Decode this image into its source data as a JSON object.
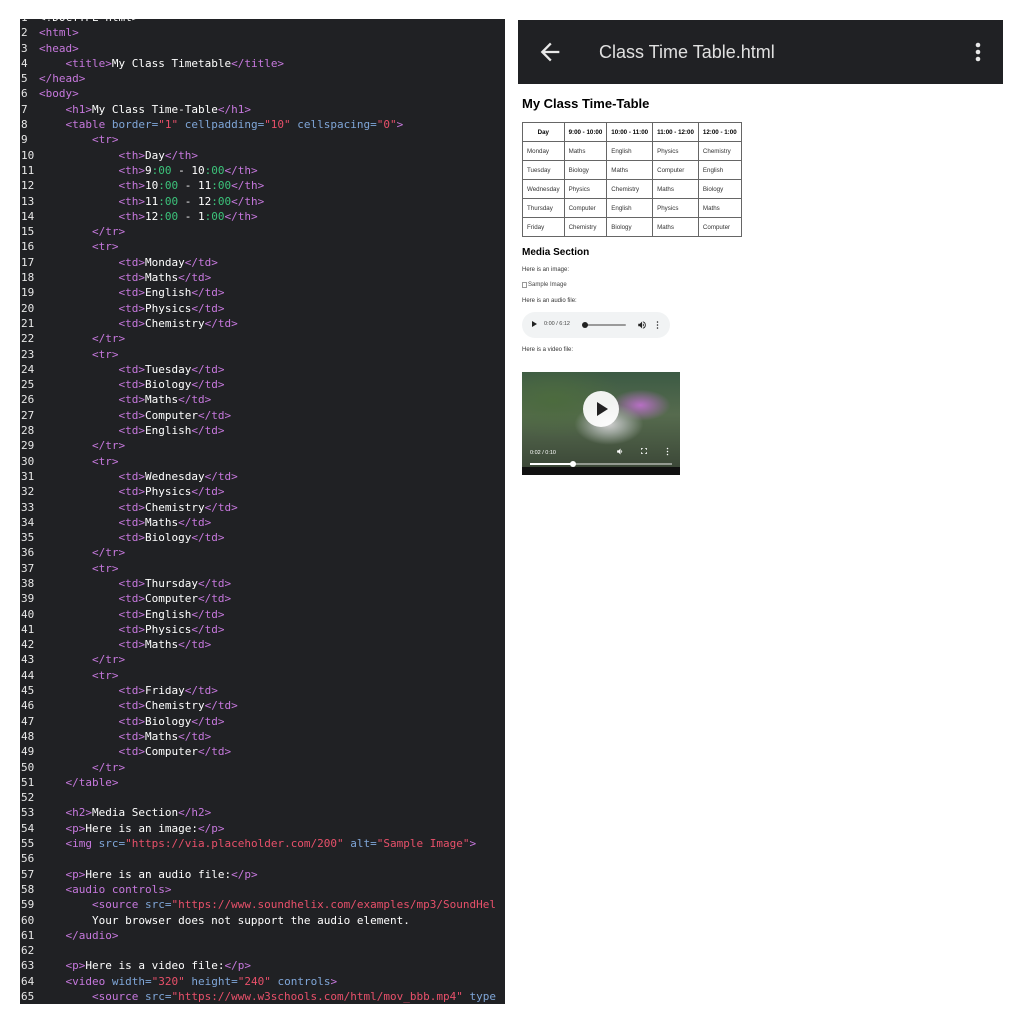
{
  "editor": {
    "lines": [
      [
        [
          "txt",
          "<!DOCTYPE html>"
        ]
      ],
      [
        [
          "tag",
          "<html>"
        ]
      ],
      [
        [
          "tag",
          "<head>"
        ]
      ],
      [
        [
          "txt",
          "    "
        ],
        [
          "tag",
          "<title>"
        ],
        [
          "txt",
          "My Class Timetable"
        ],
        [
          "tag",
          "</title>"
        ]
      ],
      [
        [
          "tag",
          "</head>"
        ]
      ],
      [
        [
          "tag",
          "<body>"
        ]
      ],
      [
        [
          "txt",
          "    "
        ],
        [
          "tag",
          "<h1>"
        ],
        [
          "txt",
          "My Class Time-Table"
        ],
        [
          "tag",
          "</h1>"
        ]
      ],
      [
        [
          "txt",
          "    "
        ],
        [
          "tag",
          "<table "
        ],
        [
          "attr",
          "border="
        ],
        [
          "str",
          "\"1\""
        ],
        [
          "attr",
          " cellpadding="
        ],
        [
          "str",
          "\"10\""
        ],
        [
          "attr",
          " cellspacing="
        ],
        [
          "str",
          "\"0\""
        ],
        [
          "tag",
          ">"
        ]
      ],
      [
        [
          "txt",
          "        "
        ],
        [
          "tag",
          "<tr>"
        ]
      ],
      [
        [
          "txt",
          "            "
        ],
        [
          "tag",
          "<th>"
        ],
        [
          "txt",
          "Day"
        ],
        [
          "tag",
          "</th>"
        ]
      ],
      [
        [
          "txt",
          "            "
        ],
        [
          "tag",
          "<th>"
        ],
        [
          "txt",
          "9"
        ],
        [
          "num",
          ":00"
        ],
        [
          "txt",
          " - 10"
        ],
        [
          "num",
          ":00"
        ],
        [
          "tag",
          "</th>"
        ]
      ],
      [
        [
          "txt",
          "            "
        ],
        [
          "tag",
          "<th>"
        ],
        [
          "txt",
          "10"
        ],
        [
          "num",
          ":00"
        ],
        [
          "txt",
          " - 11"
        ],
        [
          "num",
          ":00"
        ],
        [
          "tag",
          "</th>"
        ]
      ],
      [
        [
          "txt",
          "            "
        ],
        [
          "tag",
          "<th>"
        ],
        [
          "txt",
          "11"
        ],
        [
          "num",
          ":00"
        ],
        [
          "txt",
          " - 12"
        ],
        [
          "num",
          ":00"
        ],
        [
          "tag",
          "</th>"
        ]
      ],
      [
        [
          "txt",
          "            "
        ],
        [
          "tag",
          "<th>"
        ],
        [
          "txt",
          "12"
        ],
        [
          "num",
          ":00"
        ],
        [
          "txt",
          " - 1"
        ],
        [
          "num",
          ":00"
        ],
        [
          "tag",
          "</th>"
        ]
      ],
      [
        [
          "txt",
          "        "
        ],
        [
          "tag",
          "</tr>"
        ]
      ],
      [
        [
          "txt",
          "        "
        ],
        [
          "tag",
          "<tr>"
        ]
      ],
      [
        [
          "txt",
          "            "
        ],
        [
          "tag",
          "<td>"
        ],
        [
          "txt",
          "Monday"
        ],
        [
          "tag",
          "</td>"
        ]
      ],
      [
        [
          "txt",
          "            "
        ],
        [
          "tag",
          "<td>"
        ],
        [
          "txt",
          "Maths"
        ],
        [
          "tag",
          "</td>"
        ]
      ],
      [
        [
          "txt",
          "            "
        ],
        [
          "tag",
          "<td>"
        ],
        [
          "txt",
          "English"
        ],
        [
          "tag",
          "</td>"
        ]
      ],
      [
        [
          "txt",
          "            "
        ],
        [
          "tag",
          "<td>"
        ],
        [
          "txt",
          "Physics"
        ],
        [
          "tag",
          "</td>"
        ]
      ],
      [
        [
          "txt",
          "            "
        ],
        [
          "tag",
          "<td>"
        ],
        [
          "txt",
          "Chemistry"
        ],
        [
          "tag",
          "</td>"
        ]
      ],
      [
        [
          "txt",
          "        "
        ],
        [
          "tag",
          "</tr>"
        ]
      ],
      [
        [
          "txt",
          "        "
        ],
        [
          "tag",
          "<tr>"
        ]
      ],
      [
        [
          "txt",
          "            "
        ],
        [
          "tag",
          "<td>"
        ],
        [
          "txt",
          "Tuesday"
        ],
        [
          "tag",
          "</td>"
        ]
      ],
      [
        [
          "txt",
          "            "
        ],
        [
          "tag",
          "<td>"
        ],
        [
          "txt",
          "Biology"
        ],
        [
          "tag",
          "</td>"
        ]
      ],
      [
        [
          "txt",
          "            "
        ],
        [
          "tag",
          "<td>"
        ],
        [
          "txt",
          "Maths"
        ],
        [
          "tag",
          "</td>"
        ]
      ],
      [
        [
          "txt",
          "            "
        ],
        [
          "tag",
          "<td>"
        ],
        [
          "txt",
          "Computer"
        ],
        [
          "tag",
          "</td>"
        ]
      ],
      [
        [
          "txt",
          "            "
        ],
        [
          "tag",
          "<td>"
        ],
        [
          "txt",
          "English"
        ],
        [
          "tag",
          "</td>"
        ]
      ],
      [
        [
          "txt",
          "        "
        ],
        [
          "tag",
          "</tr>"
        ]
      ],
      [
        [
          "txt",
          "        "
        ],
        [
          "tag",
          "<tr>"
        ]
      ],
      [
        [
          "txt",
          "            "
        ],
        [
          "tag",
          "<td>"
        ],
        [
          "txt",
          "Wednesday"
        ],
        [
          "tag",
          "</td>"
        ]
      ],
      [
        [
          "txt",
          "            "
        ],
        [
          "tag",
          "<td>"
        ],
        [
          "txt",
          "Physics"
        ],
        [
          "tag",
          "</td>"
        ]
      ],
      [
        [
          "txt",
          "            "
        ],
        [
          "tag",
          "<td>"
        ],
        [
          "txt",
          "Chemistry"
        ],
        [
          "tag",
          "</td>"
        ]
      ],
      [
        [
          "txt",
          "            "
        ],
        [
          "tag",
          "<td>"
        ],
        [
          "txt",
          "Maths"
        ],
        [
          "tag",
          "</td>"
        ]
      ],
      [
        [
          "txt",
          "            "
        ],
        [
          "tag",
          "<td>"
        ],
        [
          "txt",
          "Biology"
        ],
        [
          "tag",
          "</td>"
        ]
      ],
      [
        [
          "txt",
          "        "
        ],
        [
          "tag",
          "</tr>"
        ]
      ],
      [
        [
          "txt",
          "        "
        ],
        [
          "tag",
          "<tr>"
        ]
      ],
      [
        [
          "txt",
          "            "
        ],
        [
          "tag",
          "<td>"
        ],
        [
          "txt",
          "Thursday"
        ],
        [
          "tag",
          "</td>"
        ]
      ],
      [
        [
          "txt",
          "            "
        ],
        [
          "tag",
          "<td>"
        ],
        [
          "txt",
          "Computer"
        ],
        [
          "tag",
          "</td>"
        ]
      ],
      [
        [
          "txt",
          "            "
        ],
        [
          "tag",
          "<td>"
        ],
        [
          "txt",
          "English"
        ],
        [
          "tag",
          "</td>"
        ]
      ],
      [
        [
          "txt",
          "            "
        ],
        [
          "tag",
          "<td>"
        ],
        [
          "txt",
          "Physics"
        ],
        [
          "tag",
          "</td>"
        ]
      ],
      [
        [
          "txt",
          "            "
        ],
        [
          "tag",
          "<td>"
        ],
        [
          "txt",
          "Maths"
        ],
        [
          "tag",
          "</td>"
        ]
      ],
      [
        [
          "txt",
          "        "
        ],
        [
          "tag",
          "</tr>"
        ]
      ],
      [
        [
          "txt",
          "        "
        ],
        [
          "tag",
          "<tr>"
        ]
      ],
      [
        [
          "txt",
          "            "
        ],
        [
          "tag",
          "<td>"
        ],
        [
          "txt",
          "Friday"
        ],
        [
          "tag",
          "</td>"
        ]
      ],
      [
        [
          "txt",
          "            "
        ],
        [
          "tag",
          "<td>"
        ],
        [
          "txt",
          "Chemistry"
        ],
        [
          "tag",
          "</td>"
        ]
      ],
      [
        [
          "txt",
          "            "
        ],
        [
          "tag",
          "<td>"
        ],
        [
          "txt",
          "Biology"
        ],
        [
          "tag",
          "</td>"
        ]
      ],
      [
        [
          "txt",
          "            "
        ],
        [
          "tag",
          "<td>"
        ],
        [
          "txt",
          "Maths"
        ],
        [
          "tag",
          "</td>"
        ]
      ],
      [
        [
          "txt",
          "            "
        ],
        [
          "tag",
          "<td>"
        ],
        [
          "txt",
          "Computer"
        ],
        [
          "tag",
          "</td>"
        ]
      ],
      [
        [
          "txt",
          "        "
        ],
        [
          "tag",
          "</tr>"
        ]
      ],
      [
        [
          "txt",
          "    "
        ],
        [
          "tag",
          "</table>"
        ]
      ],
      [],
      [
        [
          "txt",
          "    "
        ],
        [
          "tag",
          "<h2>"
        ],
        [
          "txt",
          "Media Section"
        ],
        [
          "tag",
          "</h2>"
        ]
      ],
      [
        [
          "txt",
          "    "
        ],
        [
          "tag",
          "<p>"
        ],
        [
          "txt",
          "Here is an image:"
        ],
        [
          "tag",
          "</p>"
        ]
      ],
      [
        [
          "txt",
          "    "
        ],
        [
          "tag",
          "<img "
        ],
        [
          "attr",
          "src="
        ],
        [
          "str",
          "\"https://via.placeholder.com/200\""
        ],
        [
          "attr",
          " alt="
        ],
        [
          "str",
          "\"Sample Image\""
        ],
        [
          "tag",
          ">"
        ]
      ],
      [],
      [
        [
          "txt",
          "    "
        ],
        [
          "tag",
          "<p>"
        ],
        [
          "txt",
          "Here is an audio file:"
        ],
        [
          "tag",
          "</p>"
        ]
      ],
      [
        [
          "txt",
          "    "
        ],
        [
          "tag",
          "<audio controls>"
        ]
      ],
      [
        [
          "txt",
          "        "
        ],
        [
          "tag",
          "<source "
        ],
        [
          "attr",
          "src="
        ],
        [
          "str",
          "\"https://www.soundhelix.com/examples/mp3/SoundHel"
        ]
      ],
      [
        [
          "txt",
          "        Your browser does not support the audio element."
        ]
      ],
      [
        [
          "txt",
          "    "
        ],
        [
          "tag",
          "</audio>"
        ]
      ],
      [],
      [
        [
          "txt",
          "    "
        ],
        [
          "tag",
          "<p>"
        ],
        [
          "txt",
          "Here is a video file:"
        ],
        [
          "tag",
          "</p>"
        ]
      ],
      [
        [
          "txt",
          "    "
        ],
        [
          "tag",
          "<video "
        ],
        [
          "attr",
          "width="
        ],
        [
          "str",
          "\"320\""
        ],
        [
          "attr",
          " height="
        ],
        [
          "str",
          "\"240\""
        ],
        [
          "attr",
          " controls"
        ],
        [
          "tag",
          ">"
        ]
      ],
      [
        [
          "txt",
          "        "
        ],
        [
          "tag",
          "<source "
        ],
        [
          "attr",
          "src="
        ],
        [
          "str",
          "\"https://www.w3schools.com/html/mov_bbb.mp4\""
        ],
        [
          "attr",
          " type"
        ]
      ]
    ]
  },
  "appbar": {
    "title": "Class Time Table.html",
    "back_icon": "arrow-left-icon",
    "menu_icon": "more-vert-icon"
  },
  "page": {
    "heading": "My Class Time-Table",
    "table": {
      "headers": [
        "Day",
        "9:00 - 10:00",
        "10:00 - 11:00",
        "11:00 - 12:00",
        "12:00 - 1:00"
      ],
      "rows": [
        [
          "Monday",
          "Maths",
          "English",
          "Physics",
          "Chemistry"
        ],
        [
          "Tuesday",
          "Biology",
          "Maths",
          "Computer",
          "English"
        ],
        [
          "Wednesday",
          "Physics",
          "Chemistry",
          "Maths",
          "Biology"
        ],
        [
          "Thursday",
          "Computer",
          "English",
          "Physics",
          "Maths"
        ],
        [
          "Friday",
          "Chemistry",
          "Biology",
          "Maths",
          "Computer"
        ]
      ]
    },
    "media_heading": "Media Section",
    "image_label": "Here is an image:",
    "image_alt": "Sample Image",
    "audio_label": "Here is an audio file:",
    "audio": {
      "time": "0:00 / 6:12",
      "progress": 0.0
    },
    "video_label": "Here is a video file:",
    "video": {
      "time": "0:02 / 0:10",
      "progress": 0.3
    }
  },
  "colors": {
    "editor_bg": "#202124",
    "tag": "#c678dd",
    "attr": "#7fa6d8",
    "string": "#e8506a",
    "number": "#3cc27a",
    "appbar_bg": "#202124"
  }
}
